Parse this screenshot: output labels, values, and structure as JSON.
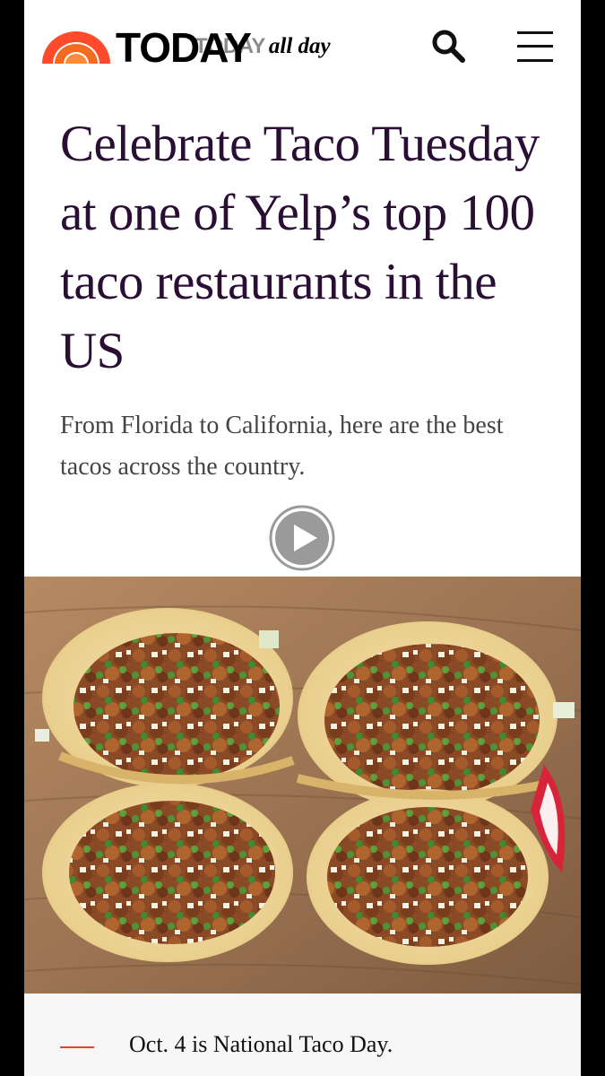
{
  "header": {
    "logo_text": "TODAY",
    "show_brand": "TODAY",
    "show_tagline": "all day",
    "icons": {
      "logo": "today-sunrise-logo",
      "search": "search-icon",
      "menu": "hamburger-menu-icon"
    },
    "brand_colors": [
      "#ff4b2b",
      "#f26b21",
      "#fa8a3c"
    ]
  },
  "article": {
    "headline": "Celebrate Taco Tuesday at one of Yelp’s top 100 taco restaurants in the US",
    "dek": "From Florida to California, here are the best tacos across the country.",
    "play_icon": "play-icon",
    "hero_image": "four-tacos-on-wooden-board-image"
  },
  "bullets": [
    {
      "text": "Oct. 4 is National Taco Day."
    }
  ],
  "colors": {
    "headline": "#2a0f35",
    "dek": "#444444",
    "accent": "#e0452c"
  }
}
